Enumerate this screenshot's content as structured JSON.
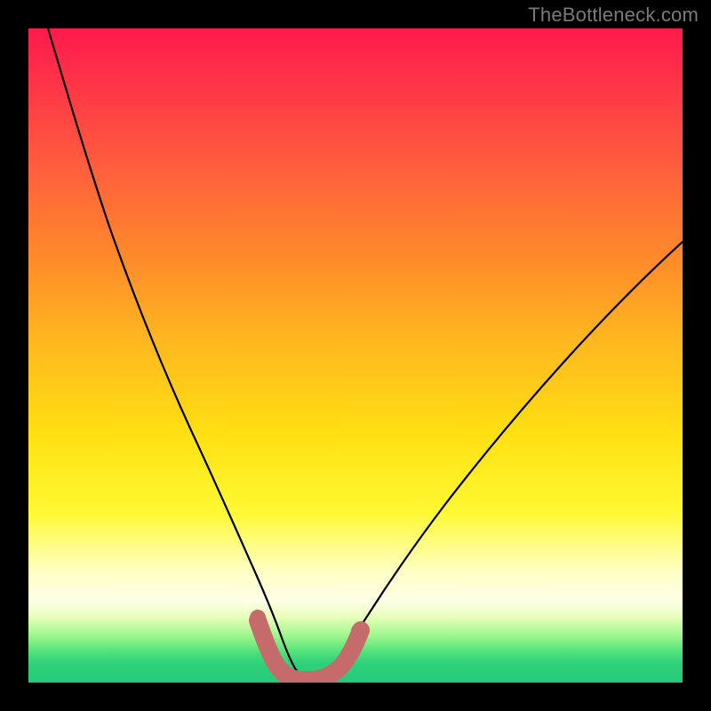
{
  "watermark": {
    "text": "TheBottleneck.com"
  },
  "colors": {
    "frame": "#000000",
    "curve": "#000000",
    "highlight": "#c66b6b",
    "gradient_stops": [
      "#ff1a4d",
      "#ff3348",
      "#ff5a3e",
      "#ff8a2a",
      "#ffb81f",
      "#ffe012",
      "#fff934",
      "#ffffc5",
      "#ffffe8",
      "#e7ffb8",
      "#99f58a",
      "#4de07a",
      "#2fd27a",
      "#25c97c"
    ]
  },
  "chart_data": {
    "type": "line",
    "title": "",
    "xlabel": "",
    "ylabel": "",
    "xlim": [
      0,
      100
    ],
    "ylim": [
      0,
      100
    ],
    "series": [
      {
        "name": "bottleneck-curve",
        "x": [
          3,
          5,
          8,
          12,
          16,
          20,
          24,
          28,
          31,
          33,
          35,
          37,
          39,
          41,
          43,
          45,
          48,
          52,
          57,
          63,
          70,
          78,
          86,
          94,
          100
        ],
        "y": [
          100,
          92,
          82,
          70,
          58,
          46,
          35,
          24,
          15,
          10,
          6,
          3,
          1.5,
          1,
          1,
          1.5,
          3,
          6,
          11,
          18,
          26,
          35,
          44,
          53,
          60
        ]
      },
      {
        "name": "optimal-range-highlight",
        "x": [
          33,
          34,
          35,
          36,
          37,
          38,
          39,
          40,
          41,
          42,
          43,
          44,
          45,
          46,
          47
        ],
        "y": [
          10,
          7,
          5,
          3.5,
          2.5,
          1.8,
          1.3,
          1,
          1,
          1.2,
          1.6,
          2.2,
          3,
          4,
          5
        ]
      }
    ],
    "grid": false,
    "legend": false
  }
}
